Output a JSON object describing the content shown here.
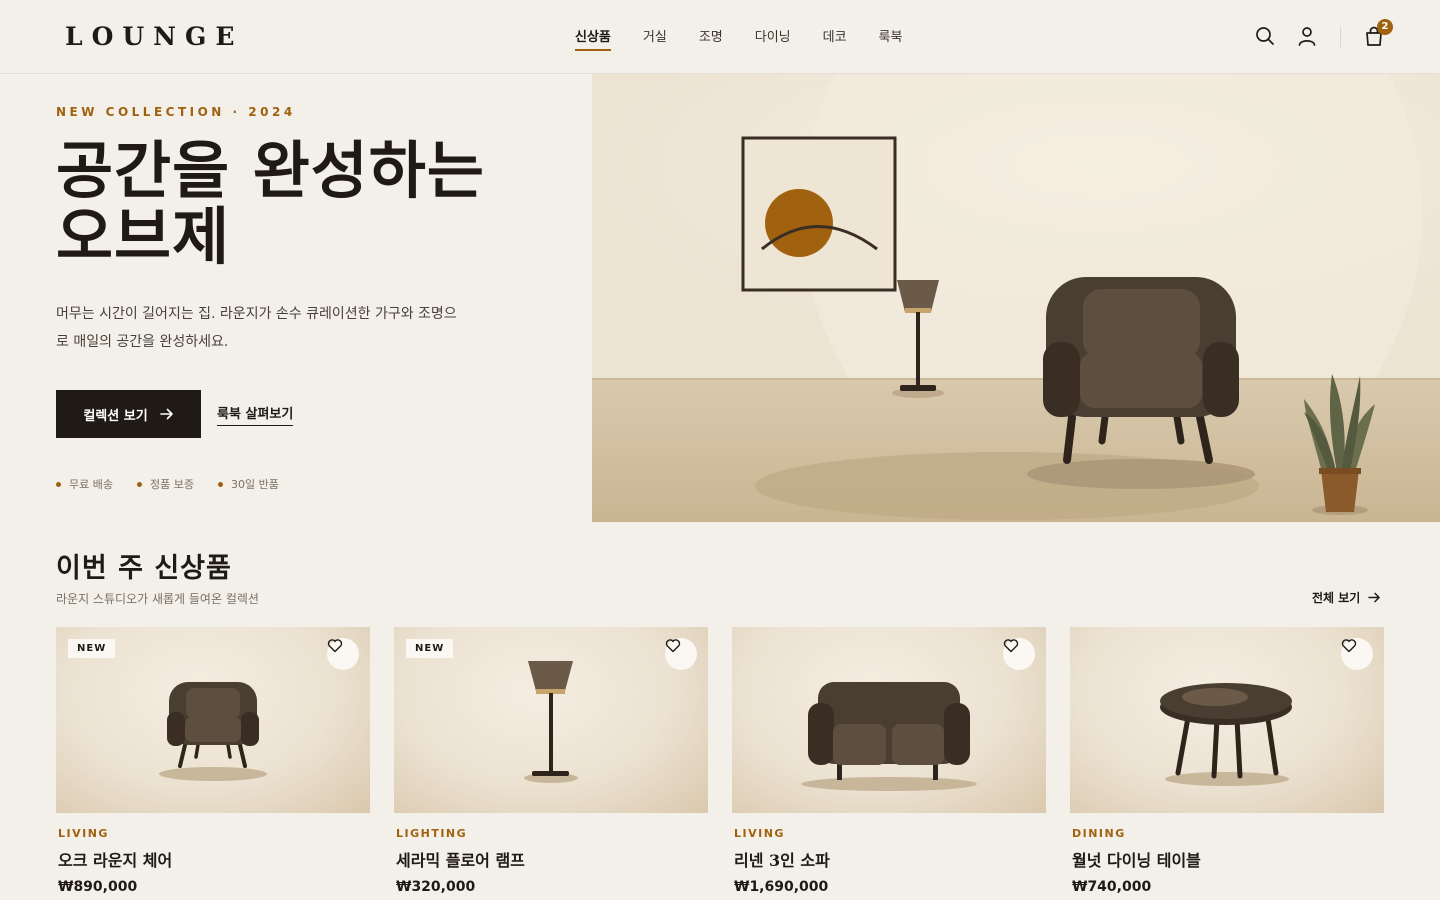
{
  "brand": {
    "logo": "LOUNGE"
  },
  "nav": {
    "items": [
      {
        "label": "신상품",
        "active": true
      },
      {
        "label": "거실",
        "active": false
      },
      {
        "label": "조명",
        "active": false
      },
      {
        "label": "다이닝",
        "active": false
      },
      {
        "label": "데코",
        "active": false
      },
      {
        "label": "룩북",
        "active": false
      }
    ]
  },
  "header_icons": {
    "search": "search-icon",
    "account": "user-icon",
    "cart": "bag-icon",
    "cart_count": "2"
  },
  "hero": {
    "eyebrow": "NEW COLLECTION · 2024",
    "title_line1": "공간을 완성하는",
    "title_line2": "오브제",
    "description": "머무는 시간이 길어지는 집. 라운지가 손수 큐레이션한 가구와 조명으로 매일의 공간을 완성하세요.",
    "primary_cta": "컬렉션 보기",
    "secondary_cta": "룩북 살펴보기",
    "perks": [
      "무료 배송",
      "정품 보증",
      "30일 반품"
    ]
  },
  "new_arrivals": {
    "title": "이번 주 신상품",
    "subtitle": "라운지 스튜디오가 새롭게 들여온 컬렉션",
    "view_all": "전체 보기",
    "products": [
      {
        "badge": "NEW",
        "category": "LIVING",
        "name": "오크 라운지 체어",
        "price": "₩890,000",
        "illustration": "chair"
      },
      {
        "badge": "NEW",
        "category": "LIGHTING",
        "name": "세라믹 플로어 램프",
        "price": "₩320,000",
        "illustration": "floor-lamp"
      },
      {
        "badge": "",
        "category": "LIVING",
        "name": "리넨 3인 소파",
        "price": "₩1,690,000",
        "illustration": "sofa"
      },
      {
        "badge": "",
        "category": "DINING",
        "name": "월넛 다이닝 테이블",
        "price": "₩740,000",
        "illustration": "round-table"
      }
    ]
  },
  "colors": {
    "accent": "#a0620e",
    "dark": "#1f1a16",
    "background": "#f3efe9",
    "furniture": "#4a3d31"
  }
}
